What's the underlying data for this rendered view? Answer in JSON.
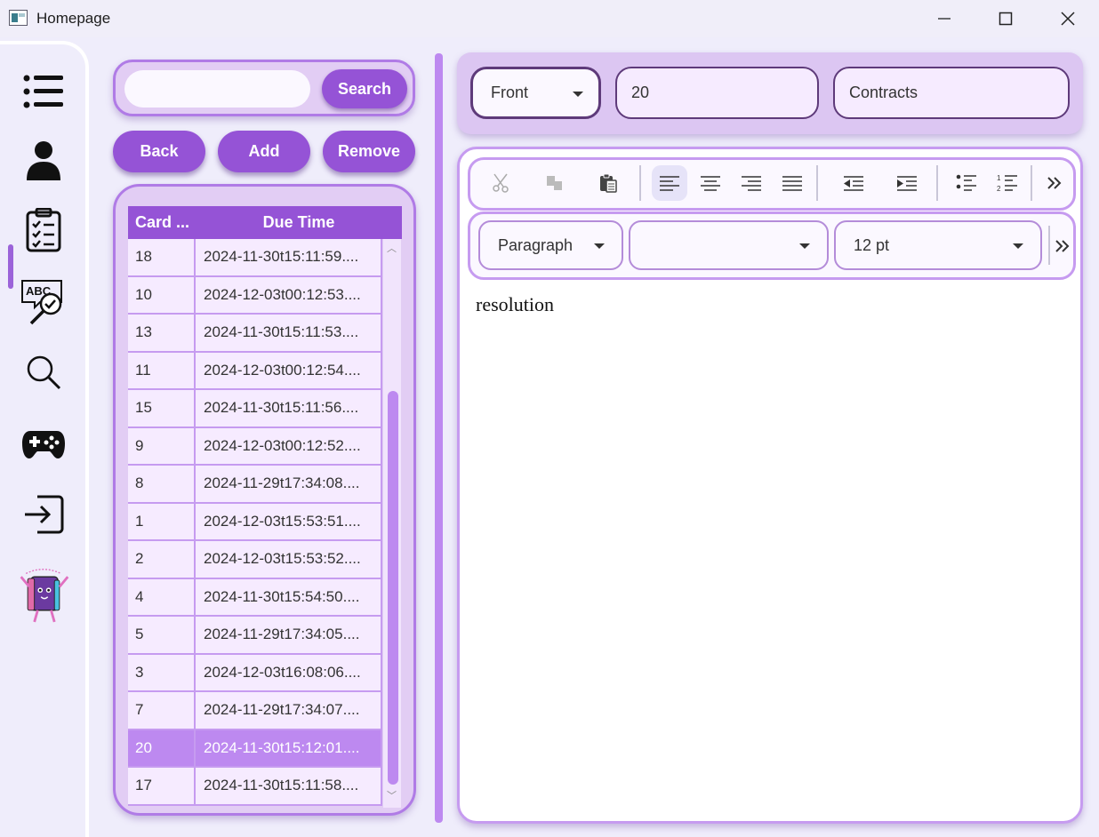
{
  "window": {
    "title": "Homepage",
    "minimize_icon": "minimize-icon",
    "maximize_icon": "maximize-icon",
    "close_icon": "close-icon"
  },
  "rail": {
    "items": [
      {
        "name": "list-icon"
      },
      {
        "name": "user-icon"
      },
      {
        "name": "checklist-icon",
        "active": true
      },
      {
        "name": "spellcheck-icon"
      },
      {
        "name": "search-icon"
      },
      {
        "name": "gamepad-icon"
      },
      {
        "name": "login-icon"
      },
      {
        "name": "book-mascot-icon"
      }
    ]
  },
  "search": {
    "value": "",
    "button_label": "Search"
  },
  "actions": {
    "back_label": "Back",
    "add_label": "Add",
    "remove_label": "Remove"
  },
  "table": {
    "columns": [
      "Card ...",
      "Due Time"
    ],
    "rows": [
      {
        "card": "18",
        "due": "2024-11-30t15:11:59...."
      },
      {
        "card": "10",
        "due": "2024-12-03t00:12:53...."
      },
      {
        "card": "13",
        "due": "2024-11-30t15:11:53...."
      },
      {
        "card": "11",
        "due": "2024-12-03t00:12:54...."
      },
      {
        "card": "15",
        "due": "2024-11-30t15:11:56...."
      },
      {
        "card": "9",
        "due": "2024-12-03t00:12:52...."
      },
      {
        "card": "8",
        "due": "2024-11-29t17:34:08...."
      },
      {
        "card": "1",
        "due": "2024-12-03t15:53:51...."
      },
      {
        "card": "2",
        "due": "2024-12-03t15:53:52...."
      },
      {
        "card": "4",
        "due": "2024-11-30t15:54:50...."
      },
      {
        "card": "5",
        "due": "2024-11-29t17:34:05...."
      },
      {
        "card": "3",
        "due": "2024-12-03t16:08:06...."
      },
      {
        "card": "7",
        "due": "2024-11-29t17:34:07...."
      },
      {
        "card": "20",
        "due": "2024-11-30t15:12:01....",
        "selected": true
      },
      {
        "card": "17",
        "due": "2024-11-30t15:11:58...."
      }
    ]
  },
  "card_fields": {
    "side_value": "Front",
    "card_number": "20",
    "deck_name": "Contracts"
  },
  "editor": {
    "toolbar1": [
      "cut-icon",
      "copy-icon",
      "paste-icon",
      "align-left-icon",
      "align-center-icon",
      "align-right-icon",
      "align-justify-icon",
      "outdent-icon",
      "indent-icon",
      "bullet-list-icon",
      "numbered-list-icon",
      "more-icon"
    ],
    "paragraph_style": "Paragraph",
    "font_family_value": "",
    "font_size": "12 pt",
    "content": "resolution"
  },
  "colors": {
    "accent": "#9553d6",
    "panel": "#e2cdf4",
    "border": "#b07be6",
    "selected_row": "#bd89f0",
    "background": "#efedfb"
  }
}
